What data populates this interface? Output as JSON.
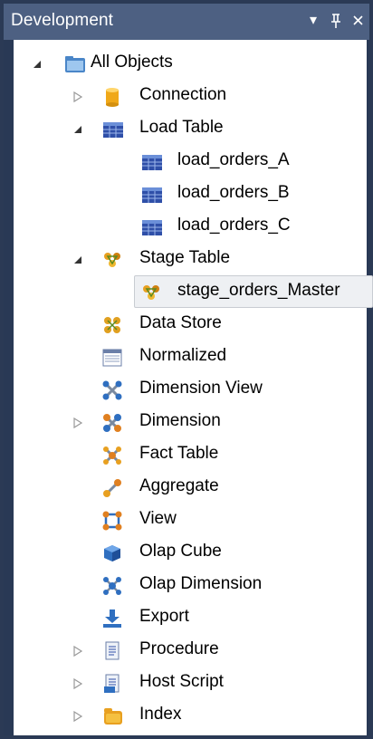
{
  "panel": {
    "title": "Development",
    "buttons": {
      "dropdown": "▾",
      "pin": "ᵖ",
      "close": "×"
    }
  },
  "tree": {
    "root": "All Objects",
    "connection": "Connection",
    "load_table": "Load Table",
    "load_children": [
      "load_orders_A",
      "load_orders_B",
      "load_orders_C"
    ],
    "stage_table": "Stage Table",
    "stage_children": [
      "stage_orders_Master"
    ],
    "data_store": "Data Store",
    "normalized": "Normalized",
    "dimension_view": "Dimension View",
    "dimension": "Dimension",
    "fact_table": "Fact Table",
    "aggregate": "Aggregate",
    "view": "View",
    "olap_cube": "Olap Cube",
    "olap_dimension": "Olap Dimension",
    "export": "Export",
    "procedure": "Procedure",
    "host_script": "Host Script",
    "index": "Index"
  },
  "icons": {
    "folder": "folder-icon",
    "connection": "database-cylinder-icon",
    "table": "table-icon",
    "stage": "stage-star-icon",
    "data_store": "data-store-icon",
    "normalized": "normalized-icon",
    "dimension_view": "dimension-view-icon",
    "dimension": "dimension-icon",
    "fact": "fact-table-icon",
    "aggregate": "aggregate-icon",
    "view": "view-icon",
    "olap_cube": "olap-cube-icon",
    "olap_dimension": "olap-dimension-icon",
    "export": "export-icon",
    "procedure": "procedure-icon",
    "host_script": "host-script-icon",
    "index": "index-icon"
  }
}
